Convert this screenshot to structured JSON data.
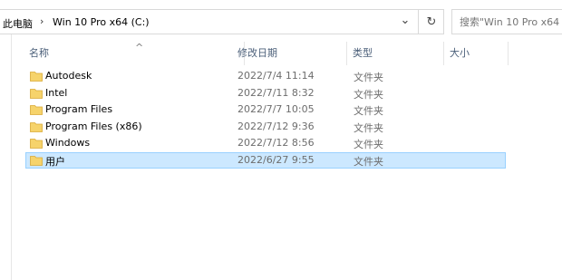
{
  "address_bar": {
    "crumbs": [
      "此电脑",
      "Win 10 Pro x64 (C:)"
    ],
    "separator_icon": "chevron-right",
    "dropdown_icon": "chevron-down",
    "refresh_icon": "refresh",
    "separator_glyph": "›",
    "dropdown_glyph": "⌄",
    "refresh_glyph": "↻"
  },
  "search": {
    "placeholder": "搜索\"Win 10 Pro x64 (C:)\""
  },
  "columns": [
    {
      "label": "名称",
      "sort": "ascending",
      "sort_glyph": "^"
    },
    {
      "label": "修改日期"
    },
    {
      "label": "类型"
    },
    {
      "label": "大小"
    }
  ],
  "files": [
    {
      "name": "Autodesk",
      "modified": "2022/7/4 11:14",
      "type": "文件夹",
      "selected": false
    },
    {
      "name": "Intel",
      "modified": "2022/7/11 8:32",
      "type": "文件夹",
      "selected": false
    },
    {
      "name": "Program Files",
      "modified": "2022/7/7 10:05",
      "type": "文件夹",
      "selected": false
    },
    {
      "name": "Program Files (x86)",
      "modified": "2022/7/12 9:36",
      "type": "文件夹",
      "selected": false
    },
    {
      "name": "Windows",
      "modified": "2022/7/12 8:56",
      "type": "文件夹",
      "selected": false
    },
    {
      "name": "用户",
      "modified": "2022/6/27 9:55",
      "type": "文件夹",
      "selected": true
    }
  ],
  "colors": {
    "selection_fill": "#cce8ff",
    "selection_border": "#99d1ff",
    "folder": "#f6d36b",
    "header_text": "#4c607a"
  }
}
